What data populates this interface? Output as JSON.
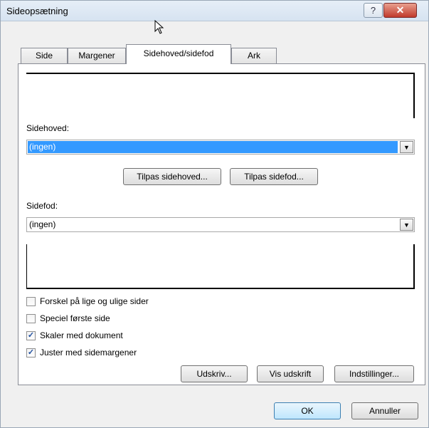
{
  "window": {
    "title": "Sideopsætning",
    "help_label": "?",
    "close_label": "✕"
  },
  "tabs": [
    {
      "label": "Side"
    },
    {
      "label": "Margener"
    },
    {
      "label": "Sidehoved/sidefod",
      "active": true
    },
    {
      "label": "Ark"
    }
  ],
  "header": {
    "label": "Sidehoved:",
    "value": "(ingen)"
  },
  "customize": {
    "header_button": "Tilpas sidehoved...",
    "footer_button": "Tilpas sidefod..."
  },
  "footer": {
    "label": "Sidefod:",
    "value": "(ingen)"
  },
  "options": [
    {
      "label": "Forskel på lige og ulige sider",
      "checked": false,
      "mark": ""
    },
    {
      "label": "Speciel første side",
      "checked": false,
      "mark": ""
    },
    {
      "label": "Skaler med dokument",
      "checked": true,
      "mark": "✓"
    },
    {
      "label": "Juster med sidemargener",
      "checked": true,
      "mark": "✓"
    }
  ],
  "action_buttons": {
    "print": "Udskriv...",
    "print_preview": "Vis udskrift",
    "settings": "Indstillinger..."
  },
  "dialog_buttons": {
    "ok": "OK",
    "cancel": "Annuller"
  },
  "dropdown_arrow": "▼"
}
